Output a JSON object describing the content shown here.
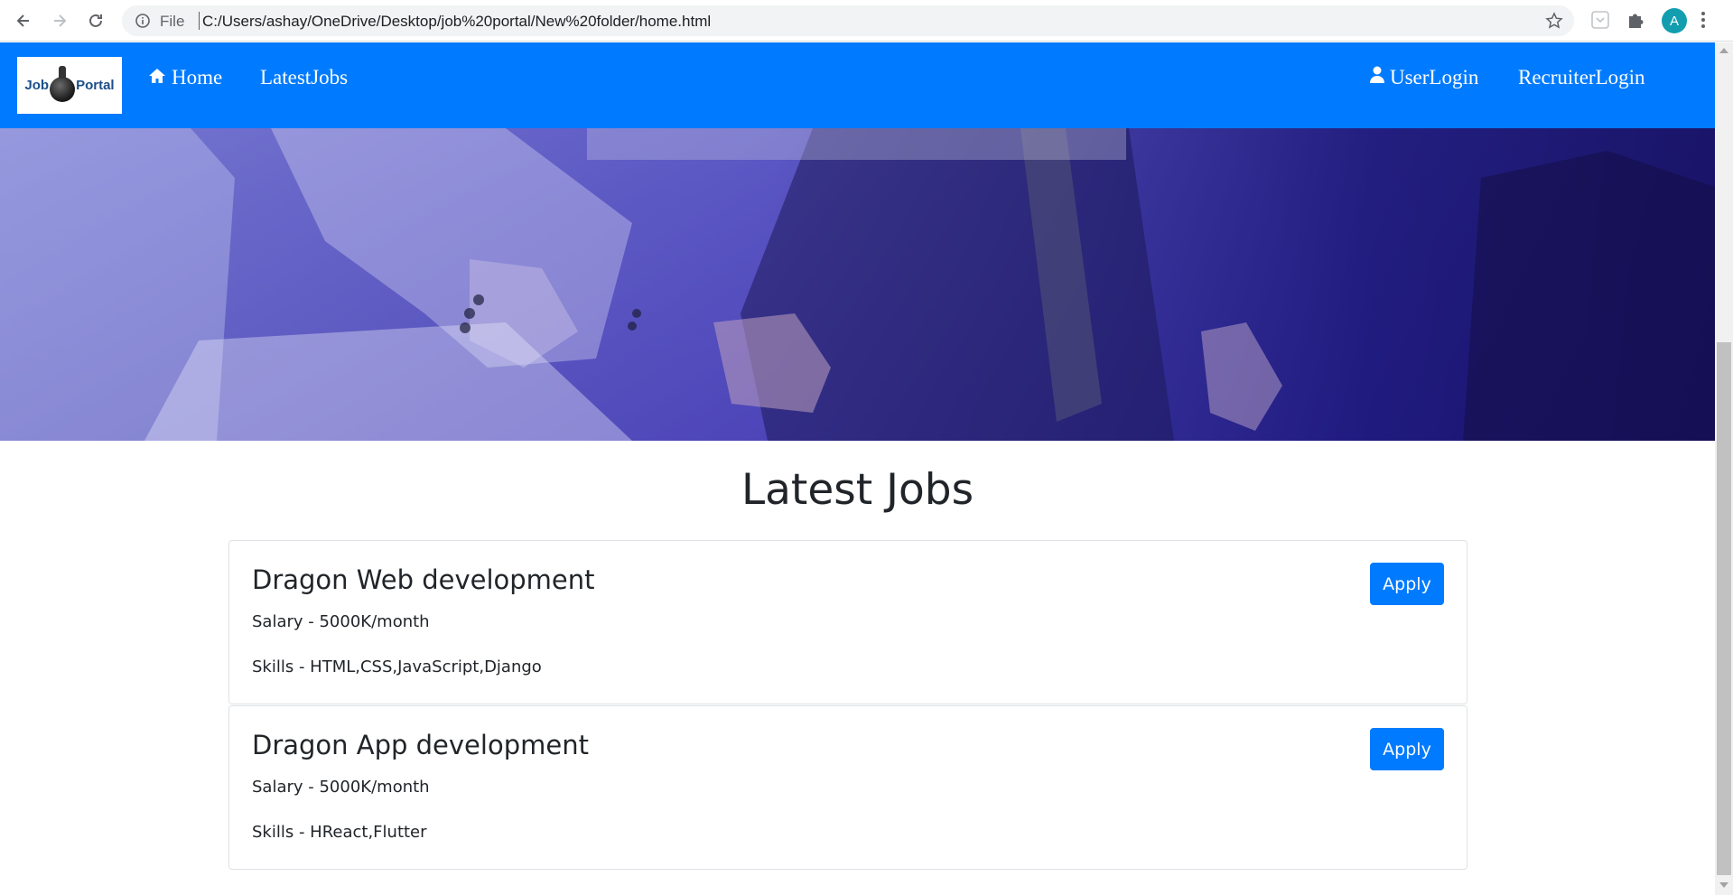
{
  "browser": {
    "scheme_label": "File",
    "url": "C:/Users/ashay/OneDrive/Desktop/job%20portal/New%20folder/home.html",
    "profile_initial": "A",
    "profile_color": "#129eaf"
  },
  "navbar": {
    "brand_word1": "Job",
    "brand_word2": "Portal",
    "links_left": [
      {
        "label": "Home",
        "icon": "home-icon"
      },
      {
        "label": "LatestJobs"
      }
    ],
    "links_right": [
      {
        "label": "UserLogin",
        "icon": "user-icon"
      },
      {
        "label": "RecruiterLogin"
      }
    ],
    "color": "#007bff"
  },
  "main": {
    "section_title": "Latest Jobs",
    "jobs": [
      {
        "title": "Dragon Web development",
        "salary": "Salary - 5000K/month",
        "skills": "Skills - HTML,CSS,JavaScript,Django",
        "apply_label": "Apply"
      },
      {
        "title": "Dragon App development",
        "salary": "Salary - 5000K/month",
        "skills": "Skills - HReact,Flutter",
        "apply_label": "Apply"
      }
    ]
  }
}
